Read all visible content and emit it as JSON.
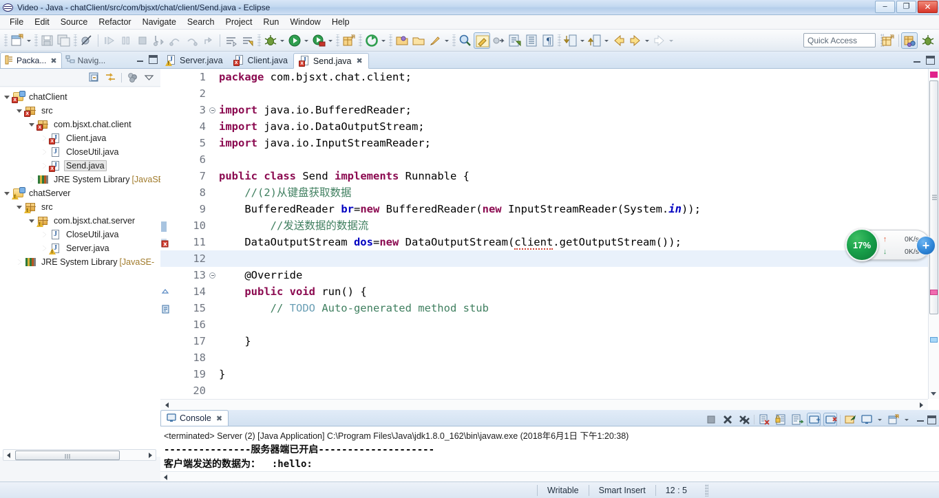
{
  "window": {
    "title": "Video - Java - chatClient/src/com/bjsxt/chat/client/Send.java - Eclipse",
    "app_icon": "eclipse-icon",
    "minimize": "–",
    "maximize": "❐",
    "close": "✕"
  },
  "menubar": {
    "items": [
      "File",
      "Edit",
      "Source",
      "Refactor",
      "Navigate",
      "Search",
      "Project",
      "Run",
      "Window",
      "Help"
    ]
  },
  "toolbar": {
    "quick_access_placeholder": "Quick Access",
    "icons": [
      "new-wizard-icon",
      "new-dropdown-arrow",
      "save-icon",
      "save-all-icon",
      "toggle-breakpoint-icon",
      "resume-icon",
      "suspend-icon",
      "terminate-icon",
      "step-into-icon",
      "step-over-icon",
      "step-return-icon",
      "drop-to-frame-icon",
      "next-annotation-icon",
      "previous-annotation-icon",
      "debug-icon",
      "debug-dropdown-arrow",
      "run-icon",
      "run-dropdown-arrow",
      "coverage-icon",
      "coverage-dropdown-arrow",
      "new-java-project-icon",
      "external-tools-icon",
      "external-tools-dropdown-arrow",
      "new-package-icon",
      "open-type-icon",
      "new-class-icon",
      "new-class-dropdown-arrow",
      "search-icon",
      "toggle-mark-occurrences-icon",
      "link-editor-icon",
      "open-task-icon",
      "show-whitespace-icon",
      "pilcrow-icon",
      "next-edit-icon",
      "next-edit-dropdown-arrow",
      "previous-edit-icon",
      "previous-edit-dropdown-arrow",
      "back-icon",
      "back-dropdown-arrow",
      "forward-icon",
      "forward-dropdown-arrow"
    ],
    "perspective_icons": [
      "open-perspective-icon",
      "java-perspective-icon",
      "debug-perspective-icon"
    ]
  },
  "left_panel": {
    "tabs": [
      {
        "label": "Packa...",
        "icon": "package-explorer-icon",
        "active": true,
        "close": "✖"
      },
      {
        "label": "Navig...",
        "icon": "navigator-icon",
        "active": false
      }
    ],
    "view_buttons": [
      "minimize-view-icon",
      "maximize-view-icon"
    ],
    "view_toolbar_icons": [
      "collapse-all-icon",
      "link-with-editor-icon",
      "focus-on-active-task-icon",
      "view-menu-icon"
    ],
    "tree": [
      {
        "label": "chatClient",
        "indent": 0,
        "twist": "open",
        "icon": "java-project-icon",
        "badge": "error",
        "selected": false
      },
      {
        "label": "src",
        "indent": 1,
        "twist": "open",
        "icon": "source-folder-icon",
        "badge": "error",
        "selected": false
      },
      {
        "label": "com.bjsxt.chat.client",
        "indent": 2,
        "twist": "open",
        "icon": "package-icon",
        "badge": "error",
        "selected": false
      },
      {
        "label": "Client.java",
        "indent": 3,
        "twist": "closed",
        "icon": "java-file-icon",
        "badge": "error",
        "selected": false
      },
      {
        "label": "CloseUtil.java",
        "indent": 3,
        "twist": "closed",
        "icon": "java-file-icon",
        "badge": "none",
        "selected": false
      },
      {
        "label": "Send.java",
        "indent": 3,
        "twist": "closed",
        "icon": "java-file-icon",
        "badge": "error",
        "selected": true
      },
      {
        "label": "JRE System Library",
        "indent": 2,
        "twist": "closed",
        "icon": "jre-library-icon",
        "badge": "none",
        "selected": false,
        "suffix": " [JavaSE-"
      },
      {
        "label": "chatServer",
        "indent": 0,
        "twist": "open",
        "icon": "java-project-icon",
        "badge": "warning",
        "selected": false
      },
      {
        "label": "src",
        "indent": 1,
        "twist": "open",
        "icon": "source-folder-icon",
        "badge": "warning",
        "selected": false
      },
      {
        "label": "com.bjsxt.chat.server",
        "indent": 2,
        "twist": "open",
        "icon": "package-icon",
        "badge": "warning",
        "selected": false
      },
      {
        "label": "CloseUtil.java",
        "indent": 3,
        "twist": "closed",
        "icon": "java-file-icon",
        "badge": "none",
        "selected": false
      },
      {
        "label": "Server.java",
        "indent": 3,
        "twist": "closed",
        "icon": "java-file-icon",
        "badge": "warning",
        "selected": false
      },
      {
        "label": "JRE System Library",
        "indent": 1,
        "twist": "closed",
        "icon": "jre-library-icon",
        "badge": "none",
        "selected": false,
        "suffix": " [JavaSE-"
      }
    ]
  },
  "editor": {
    "tabs": [
      {
        "label": "Server.java",
        "badge": "warning",
        "active": false
      },
      {
        "label": "Client.java",
        "badge": "error",
        "active": false
      },
      {
        "label": "Send.java",
        "badge": "error",
        "active": true,
        "close": "✖"
      }
    ],
    "current_line": 12,
    "lines": [
      {
        "n": 1,
        "marker": "none",
        "fold": false,
        "tokens": [
          {
            "t": "package",
            "c": "kw"
          },
          {
            "t": " com.bjsxt.chat.client;",
            "c": ""
          }
        ]
      },
      {
        "n": 2,
        "marker": "none",
        "fold": false,
        "tokens": []
      },
      {
        "n": 3,
        "marker": "none",
        "fold": true,
        "tokens": [
          {
            "t": "import",
            "c": "kw"
          },
          {
            "t": " java.io.BufferedReader;",
            "c": ""
          }
        ]
      },
      {
        "n": 4,
        "marker": "none",
        "fold": false,
        "tokens": [
          {
            "t": "import",
            "c": "kw"
          },
          {
            "t": " java.io.DataOutputStream;",
            "c": ""
          }
        ]
      },
      {
        "n": 5,
        "marker": "none",
        "fold": false,
        "tokens": [
          {
            "t": "import",
            "c": "kw"
          },
          {
            "t": " java.io.InputStreamReader;",
            "c": ""
          }
        ]
      },
      {
        "n": 6,
        "marker": "none",
        "fold": false,
        "tokens": []
      },
      {
        "n": 7,
        "marker": "none",
        "fold": false,
        "tokens": [
          {
            "t": "public",
            "c": "kw"
          },
          {
            "t": " ",
            "c": ""
          },
          {
            "t": "class",
            "c": "kw"
          },
          {
            "t": " Send ",
            "c": ""
          },
          {
            "t": "implements",
            "c": "kw"
          },
          {
            "t": " Runnable {",
            "c": ""
          }
        ]
      },
      {
        "n": 8,
        "marker": "none",
        "fold": false,
        "tokens": [
          {
            "t": "    //(2)从键盘获取数据",
            "c": "cm"
          }
        ]
      },
      {
        "n": 9,
        "marker": "none",
        "fold": false,
        "tokens": [
          {
            "t": "    BufferedReader ",
            "c": ""
          },
          {
            "t": "br",
            "c": "fld"
          },
          {
            "t": "=",
            "c": ""
          },
          {
            "t": "new",
            "c": "kw"
          },
          {
            "t": " BufferedReader(",
            "c": ""
          },
          {
            "t": "new",
            "c": "kw"
          },
          {
            "t": " InputStreamReader(System.",
            "c": ""
          },
          {
            "t": "in",
            "c": "fld-italic"
          },
          {
            "t": "));",
            "c": ""
          }
        ]
      },
      {
        "n": 10,
        "marker": "changed",
        "fold": false,
        "tokens": [
          {
            "t": "        //发送数据的数据流",
            "c": "cm"
          }
        ]
      },
      {
        "n": 11,
        "marker": "error",
        "fold": false,
        "tokens": [
          {
            "t": "    DataOutputStream ",
            "c": ""
          },
          {
            "t": "dos",
            "c": "fld"
          },
          {
            "t": "=",
            "c": ""
          },
          {
            "t": "new",
            "c": "kw"
          },
          {
            "t": " DataOutputStream(",
            "c": ""
          },
          {
            "t": "client",
            "c": "squiggle"
          },
          {
            "t": ".getOutputStream());",
            "c": ""
          }
        ]
      },
      {
        "n": 12,
        "marker": "none",
        "fold": false,
        "tokens": []
      },
      {
        "n": 13,
        "marker": "none",
        "fold": true,
        "tokens": [
          {
            "t": "    @Override",
            "c": ""
          }
        ]
      },
      {
        "n": 14,
        "marker": "override",
        "fold": false,
        "tokens": [
          {
            "t": "    ",
            "c": ""
          },
          {
            "t": "public",
            "c": "kw"
          },
          {
            "t": " ",
            "c": ""
          },
          {
            "t": "void",
            "c": "kw"
          },
          {
            "t": " run() {",
            "c": ""
          }
        ]
      },
      {
        "n": 15,
        "marker": "todo",
        "fold": false,
        "tokens": [
          {
            "t": "        // ",
            "c": "cm"
          },
          {
            "t": "TODO",
            "c": "todo"
          },
          {
            "t": " Auto-generated method stub",
            "c": "cm"
          }
        ]
      },
      {
        "n": 16,
        "marker": "none",
        "fold": false,
        "tokens": []
      },
      {
        "n": 17,
        "marker": "none",
        "fold": false,
        "tokens": [
          {
            "t": "    }",
            "c": ""
          }
        ]
      },
      {
        "n": 18,
        "marker": "none",
        "fold": false,
        "tokens": []
      },
      {
        "n": 19,
        "marker": "none",
        "fold": false,
        "tokens": [
          {
            "t": "}",
            "c": ""
          }
        ]
      },
      {
        "n": 20,
        "marker": "none",
        "fold": false,
        "tokens": []
      }
    ]
  },
  "console": {
    "tab_label": "Console",
    "tab_icon": "console-icon",
    "tab_close": "✖",
    "toolbar_icons": [
      "terminate-icon",
      "remove-launch-icon",
      "remove-all-launches-icon",
      "clear-console-icon",
      "scroll-lock-icon",
      "word-wrap-icon",
      "show-console-on-output-icon",
      "show-console-on-error-icon",
      "pin-console-icon",
      "display-selected-console-icon",
      "display-dropdown-arrow",
      "open-console-icon",
      "open-console-dropdown-arrow",
      "minimize-icon",
      "maximize-icon"
    ],
    "header": "<terminated> Server (2) [Java Application] C:\\Program Files\\Java\\jdk1.8.0_162\\bin\\javaw.exe (2018年6月1日 下午1:20:38)",
    "output_lines": [
      "---------------服务器端已开启--------------------",
      "客户端发送的数据为：  :hello:"
    ]
  },
  "network_widget": {
    "percent": "17%",
    "upload_arrow": "↑",
    "upload_speed": "0K/s",
    "download_arrow": "↓",
    "download_speed": "0K/s",
    "plus": "+"
  },
  "statusbar": {
    "writable": "Writable",
    "insert_mode": "Smart Insert",
    "position": "12 : 5"
  },
  "colors": {
    "keyword": "#8b0a50",
    "comment": "#3f7f5f",
    "field": "#0000c0",
    "todo": "#6a9fb5",
    "error": "#d33c2e",
    "warning": "#e5b52e",
    "accent": "#2f86d8",
    "net_green": "#18a04a"
  }
}
